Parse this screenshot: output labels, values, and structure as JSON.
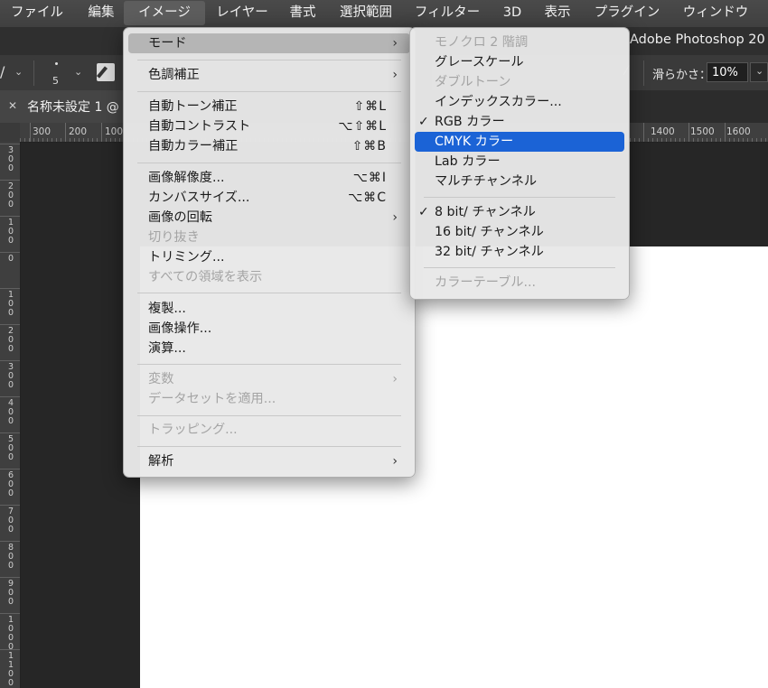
{
  "menubar": {
    "items": [
      {
        "label": "ファイル"
      },
      {
        "label": "編集"
      },
      {
        "label": "イメージ"
      },
      {
        "label": "レイヤー"
      },
      {
        "label": "書式"
      },
      {
        "label": "選択範囲"
      },
      {
        "label": "フィルター"
      },
      {
        "label": "3D"
      },
      {
        "label": "表示"
      },
      {
        "label": "プラグイン"
      },
      {
        "label": "ウィンドウ"
      }
    ]
  },
  "app": {
    "title": "Adobe Photoshop 20"
  },
  "options": {
    "brush_size": "5",
    "smoothing_label": "滑らかさ：",
    "smoothing_value": "10%"
  },
  "document": {
    "tab_title": "名称未設定 1 @"
  },
  "ruler": {
    "h_labels": [
      "300",
      "200",
      "100",
      "1400",
      "1500",
      "1600"
    ],
    "v_labels": [
      "3 0 0",
      "2 0 0",
      "1 0 0",
      "0",
      "1 0 0",
      "2 0 0",
      "3 0 0",
      "4 0 0",
      "5 0 0",
      "6 0 0",
      "7 0 0",
      "8 0 0",
      "9 0 0",
      "1 0 0 0",
      "1 1 0 0"
    ]
  },
  "image_menu": {
    "items": {
      "mode": "モード",
      "adjustments": "色調補正",
      "auto_tone": "自動トーン補正",
      "auto_tone_sc": "⇧⌘L",
      "auto_contrast": "自動コントラスト",
      "auto_contrast_sc": "⌥⇧⌘L",
      "auto_color": "自動カラー補正",
      "auto_color_sc": "⇧⌘B",
      "image_size": "画像解像度...",
      "image_size_sc": "⌥⌘I",
      "canvas_size": "カンバスサイズ...",
      "canvas_size_sc": "⌥⌘C",
      "rotation": "画像の回転",
      "crop": "切り抜き",
      "trim": "トリミング...",
      "reveal_all": "すべての領域を表示",
      "duplicate": "複製...",
      "apply_image": "画像操作...",
      "calculations": "演算...",
      "variables": "変数",
      "apply_dataset": "データセットを適用...",
      "trap": "トラッピング...",
      "analysis": "解析"
    }
  },
  "mode_menu": {
    "items": {
      "bitmap": "モノクロ 2 階調",
      "grayscale": "グレースケール",
      "duotone": "ダブルトーン",
      "indexed": "インデックスカラー...",
      "rgb": "RGB カラー",
      "cmyk": "CMYK カラー",
      "lab": "Lab カラー",
      "multichannel": "マルチチャンネル",
      "bit8": "8 bit/ チャンネル",
      "bit16": "16 bit/ チャンネル",
      "bit32": "32 bit/ チャンネル",
      "color_table": "カラーテーブル..."
    },
    "check_glyph": "✓"
  },
  "glyphs": {
    "submenu_arrow": "›",
    "close": "✕",
    "chevron": "⌄"
  },
  "colors": {
    "highlight": "#1b63d6",
    "menu_bg": "#e8e8e8",
    "menubar_bg": "#444444"
  }
}
